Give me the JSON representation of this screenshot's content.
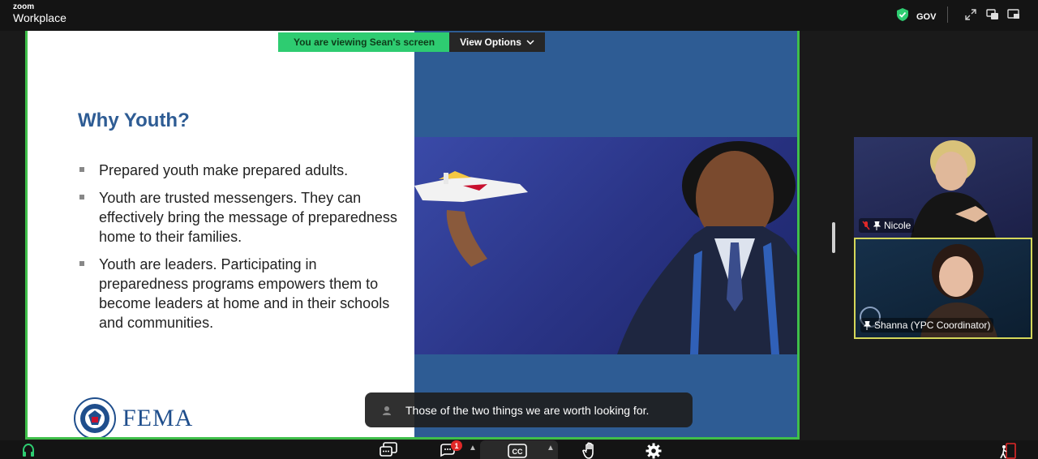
{
  "app": {
    "brand_top": "zoom",
    "brand_bottom": "Workplace"
  },
  "topbar": {
    "gov_label": "GOV",
    "icons": [
      "shield-check-icon",
      "fullscreen-icon",
      "view-icon",
      "minimize-icon"
    ],
    "shield_color": "#2ecc71"
  },
  "banner": {
    "viewing_label": "You are viewing",
    "viewing_name": "Sean's screen",
    "view_options": "View Options"
  },
  "slide": {
    "title": "Why Youth?",
    "bullets": [
      "Prepared youth make prepared adults.",
      "Youth are trusted messengers. They can effectively bring the message of preparedness home to their families.",
      "Youth are leaders. Participating in preparedness programs empowers them to become leaders at home and in their schools and communities."
    ],
    "logo_text": "FEMA"
  },
  "caption": {
    "text": "Those of the two things we are worth looking for."
  },
  "participants": [
    {
      "name": "Nicole",
      "muted": true
    },
    {
      "name": "Shanna (YPC Coordinator)",
      "muted": false
    }
  ],
  "toolbar": {
    "icons": [
      "audio-icon",
      "chat-icon",
      "reactions-icon",
      "captions-icon",
      "raise-hand-icon",
      "settings-icon",
      "leave-icon"
    ],
    "captions_label": "CC",
    "notification_count": "1"
  },
  "colors": {
    "accent_green": "#2ecc71",
    "share_border": "#3fbf4a",
    "slide_blue": "#2e5c94",
    "badge_red": "#e02828",
    "speaker_border": "#d4d75a"
  }
}
